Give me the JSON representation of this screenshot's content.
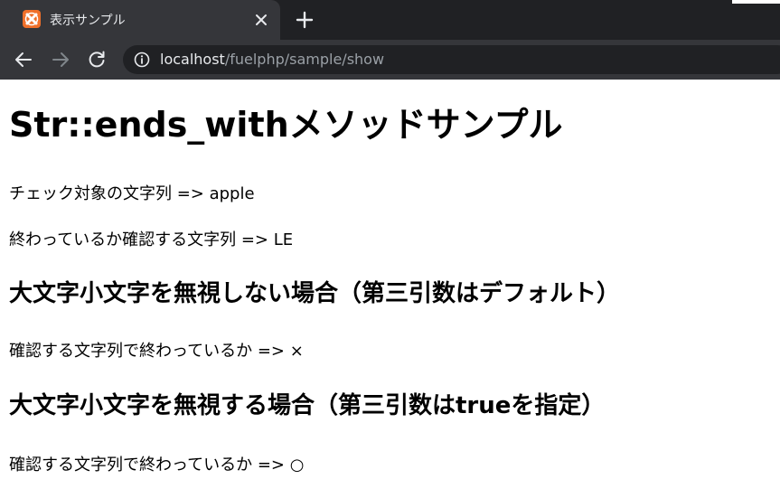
{
  "browser": {
    "tab_title": "表示サンプル",
    "url_host": "localhost",
    "url_path": "/fuelphp/sample/show",
    "colors": {
      "tabbar": "#202124",
      "toolbar": "#35363a",
      "favicon": "#f0702a"
    },
    "icons": [
      "xampp-favicon-icon",
      "close-icon",
      "plus-icon",
      "back-arrow-icon",
      "forward-arrow-icon",
      "reload-icon",
      "info-icon"
    ]
  },
  "content": {
    "heading": "Str::ends_withメソッドサンプル",
    "target_line": "チェック対象の文字列 => apple",
    "check_line": "終わっているか確認する文字列 => LE",
    "section1": {
      "heading": "大文字小文字を無視しない場合（第三引数はデフォルト）",
      "result": "確認する文字列で終わっているか => ×"
    },
    "section2": {
      "heading": "大文字小文字を無視する場合（第三引数はtrueを指定）",
      "result": "確認する文字列で終わっているか => ○"
    }
  }
}
